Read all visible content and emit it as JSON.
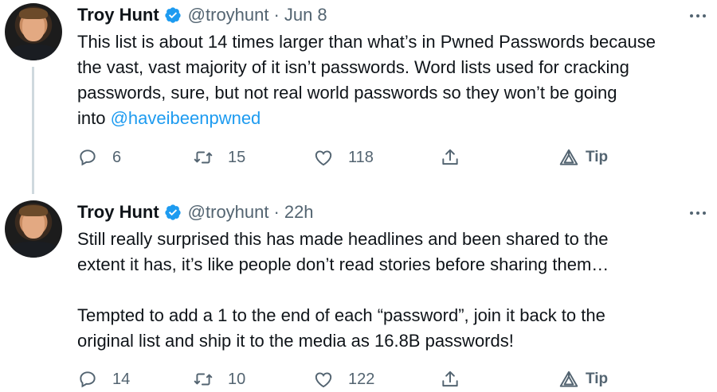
{
  "tweets": [
    {
      "name": "Troy Hunt",
      "handle": "@troyhunt",
      "separator": "·",
      "time": "Jun 8",
      "lines": [
        "This list is about 14 times larger than what’s in Pwned Passwords because",
        "the vast, vast majority of it isn’t passwords. Word lists used for cracking",
        "passwords, sure, but not real world passwords so they won’t be going"
      ],
      "last_line_prefix": "into ",
      "mention": "@haveibeenpwned",
      "replies": "6",
      "retweets": "15",
      "likes": "118",
      "tip_label": "Tip"
    },
    {
      "name": "Troy Hunt",
      "handle": "@troyhunt",
      "separator": "·",
      "time": "22h",
      "lines": [
        "Still really surprised this has made headlines and been shared to the",
        "extent it has, it’s like people don’t read stories before sharing them…",
        "",
        "Tempted to add a 1 to the end of each “password”, join it back to the",
        "original list and ship it to the media as 16.8B passwords!"
      ],
      "replies": "14",
      "retweets": "10",
      "likes": "122",
      "tip_label": "Tip"
    }
  ],
  "colors": {
    "text": "#0f1419",
    "muted": "#536471",
    "accent": "#1d9bf0",
    "thread": "#cfd9de"
  },
  "icons": [
    "verified-badge-icon",
    "more-icon",
    "reply-icon",
    "retweet-icon",
    "like-icon",
    "share-icon",
    "tip-icon"
  ]
}
